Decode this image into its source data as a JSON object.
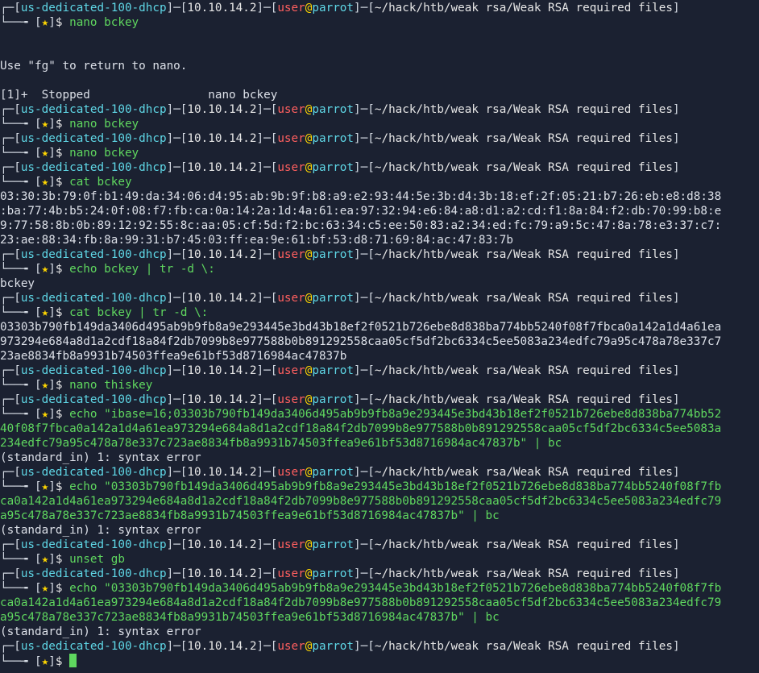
{
  "prompt": {
    "host": "us-dedicated-100-dhcp",
    "ip": "10.10.14.2",
    "user": "user",
    "at": "@",
    "machine": "parrot",
    "path": "~/hack/htb/weak rsa/Weak RSA required files",
    "star": "★",
    "dollar": "$"
  },
  "entries": [
    {
      "cmd": "nano bckey",
      "output": []
    },
    {
      "cmd": null,
      "output": [
        "",
        "",
        "Use \"fg\" to return to nano.",
        "",
        "[1]+  Stopped                 nano bckey"
      ]
    },
    {
      "cmd": "nano bckey",
      "output": []
    },
    {
      "cmd": "nano bckey",
      "output": []
    },
    {
      "cmd": "cat bckey",
      "output": [
        "03:30:3b:79:0f:b1:49:da:34:06:d4:95:ab:9b:9f:b8:a9:e2:93:44:5e:3b:d4:3b:18:ef:2f:05:21:b7:26:eb:e8:d8:38",
        ":ba:77:4b:b5:24:0f:08:f7:fb:ca:0a:14:2a:1d:4a:61:ea:97:32:94:e6:84:a8:d1:a2:cd:f1:8a:84:f2:db:70:99:b8:e",
        "9:77:58:8b:0b:89:12:92:55:8c:aa:05:cf:5d:f2:bc:63:34:c5:ee:50:83:a2:34:ed:fc:79:a9:5c:47:8a:78:e3:37:c7:",
        "23:ae:88:34:fb:8a:99:31:b7:45:03:ff:ea:9e:61:bf:53:d8:71:69:84:ac:47:83:7b"
      ]
    },
    {
      "cmd": "echo bckey | tr -d \\:",
      "output": [
        "bckey"
      ]
    },
    {
      "cmd": "cat bckey | tr -d \\:",
      "output": [
        "03303b790fb149da3406d495ab9b9fb8a9e293445e3bd43b18ef2f0521b726ebe8d838ba774bb5240f08f7fbca0a142a1d4a61ea",
        "973294e684a8d1a2cdf18a84f2db7099b8e977588b0b891292558caa05cf5df2bc6334c5ee5083a234edfc79a95c478a78e337c7",
        "23ae8834fb8a9931b74503ffea9e61bf53d8716984ac47837b"
      ]
    },
    {
      "cmd": "nano thiskey",
      "output": []
    },
    {
      "cmd": "echo \"ibase=16;03303b790fb149da3406d495ab9b9fb8a9e293445e3bd43b18ef2f0521b726ebe8d838ba774bb52\n40f08f7fbca0a142a1d4a61ea973294e684a8d1a2cdf18a84f2db7099b8e977588b0b891292558caa05cf5df2bc6334c5ee5083a\n234edfc79a95c478a78e337c723ae8834fb8a9931b74503ffea9e61bf53d8716984ac47837b\" | bc",
      "output": [
        "(standard_in) 1: syntax error"
      ]
    },
    {
      "cmd": "echo \"03303b790fb149da3406d495ab9b9fb8a9e293445e3bd43b18ef2f0521b726ebe8d838ba774bb5240f08f7fb\nca0a142a1d4a61ea973294e684a8d1a2cdf18a84f2db7099b8e977588b0b891292558caa05cf5df2bc6334c5ee5083a234edfc79\na95c478a78e337c723ae8834fb8a9931b74503ffea9e61bf53d8716984ac47837b\" | bc",
      "output": [
        "(standard_in) 1: syntax error"
      ]
    },
    {
      "cmd": "unset gb",
      "output": []
    },
    {
      "cmd": "echo \"03303b790fb149da3406d495ab9b9fb8a9e293445e3bd43b18ef2f0521b726ebe8d838ba774bb5240f08f7fb\nca0a142a1d4a61ea973294e684a8d1a2cdf18a84f2db7099b8e977588b0b891292558caa05cf5df2bc6334c5ee5083a234edfc79\na95c478a78e337c723ae8834fb8a9931b74503ffea9e61bf53d8716984ac47837b\" | bc",
      "output": [
        "(standard_in) 1: syntax error"
      ]
    },
    {
      "cmd": "",
      "output": [],
      "active": true
    }
  ],
  "colors": {
    "background": "#1b2131",
    "bracket": "#d5dbe4",
    "host": "#5fd7e6",
    "user": "#ff5f5f",
    "star": "#ffd700",
    "command": "#5fd75f",
    "cursor": "#5fd75f"
  }
}
